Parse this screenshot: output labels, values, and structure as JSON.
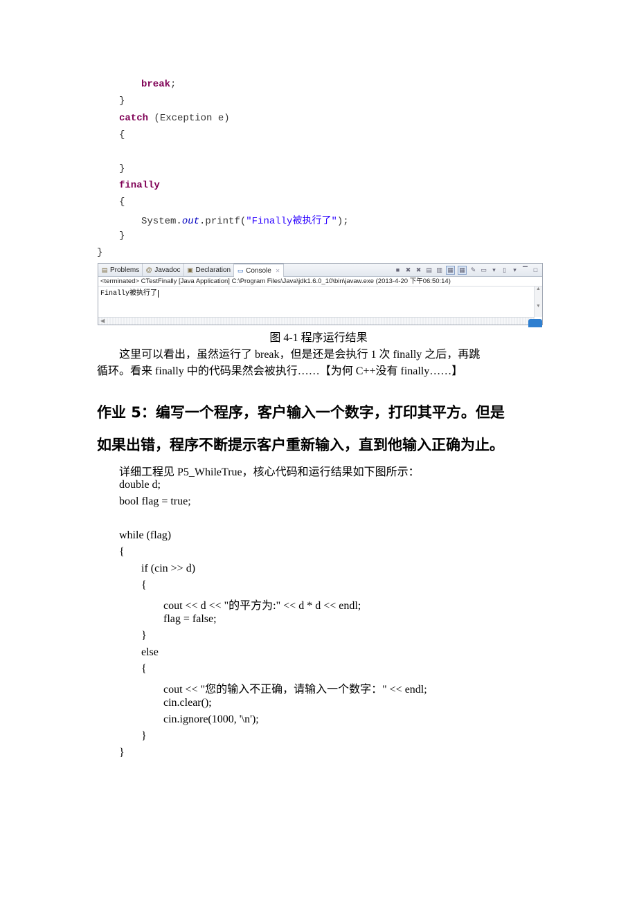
{
  "java_code": {
    "lines": [
      {
        "indent": 2,
        "parts": [
          {
            "t": "kw",
            "v": "break"
          },
          {
            "t": "plain",
            "v": ";"
          }
        ]
      },
      {
        "indent": 1,
        "parts": [
          {
            "t": "plain",
            "v": "}"
          }
        ]
      },
      {
        "indent": 1,
        "parts": [
          {
            "t": "kw",
            "v": "catch"
          },
          {
            "t": "plain",
            "v": " (Exception e)"
          }
        ]
      },
      {
        "indent": 1,
        "parts": [
          {
            "t": "plain",
            "v": "{"
          }
        ]
      },
      {
        "indent": 1,
        "parts": [
          {
            "t": "plain",
            "v": ""
          }
        ]
      },
      {
        "indent": 1,
        "parts": [
          {
            "t": "plain",
            "v": "}"
          }
        ]
      },
      {
        "indent": 1,
        "parts": [
          {
            "t": "kw",
            "v": "finally"
          }
        ]
      },
      {
        "indent": 1,
        "parts": [
          {
            "t": "plain",
            "v": "{"
          }
        ]
      },
      {
        "indent": 2,
        "parts": [
          {
            "t": "plain",
            "v": "System."
          },
          {
            "t": "ital",
            "v": "out"
          },
          {
            "t": "plain",
            "v": ".printf("
          },
          {
            "t": "str",
            "v": "\"Finally被执行了\""
          },
          {
            "t": "plain",
            "v": ");"
          }
        ]
      },
      {
        "indent": 1,
        "parts": [
          {
            "t": "plain",
            "v": "}"
          }
        ]
      },
      {
        "indent": 0,
        "parts": [
          {
            "t": "plain",
            "v": "}"
          }
        ]
      }
    ]
  },
  "console": {
    "tabs": [
      {
        "icon": "problems-icon",
        "glyph": "▤",
        "label": "Problems",
        "active": false
      },
      {
        "icon": "javadoc-icon",
        "glyph": "@",
        "label": "Javadoc",
        "active": false
      },
      {
        "icon": "declaration-icon",
        "glyph": "▣",
        "label": "Declaration",
        "active": false
      },
      {
        "icon": "console-icon",
        "glyph": "▭",
        "label": "Console",
        "active": true,
        "close": "✕"
      }
    ],
    "toolbar": [
      {
        "name": "terminate-icon",
        "glyph": "■",
        "pressed": false
      },
      {
        "name": "remove-launch-icon",
        "glyph": "✖",
        "pressed": false
      },
      {
        "name": "remove-all-terminated-icon",
        "glyph": "✖",
        "pressed": false
      },
      {
        "name": "clear-console-icon",
        "glyph": "▤",
        "pressed": false
      },
      {
        "name": "scroll-lock-icon",
        "glyph": "▥",
        "pressed": false
      },
      {
        "name": "show-on-stdout-icon",
        "glyph": "▦",
        "pressed": true
      },
      {
        "name": "show-on-stderr-icon",
        "glyph": "▦",
        "pressed": true
      },
      {
        "name": "pin-console-icon",
        "glyph": "✎",
        "pressed": false
      },
      {
        "name": "display-console-icon",
        "glyph": "▭",
        "pressed": false
      },
      {
        "name": "display-console-dropdown-icon",
        "glyph": "▾",
        "pressed": false
      },
      {
        "name": "open-console-icon",
        "glyph": "▯",
        "pressed": false
      },
      {
        "name": "open-console-dropdown-icon",
        "glyph": "▾",
        "pressed": false
      },
      {
        "name": "minimize-icon",
        "glyph": "▔",
        "pressed": false
      },
      {
        "name": "maximize-icon",
        "glyph": "□",
        "pressed": false
      }
    ],
    "status": "<terminated> CTestFinally [Java Application] C:\\Program Files\\Java\\jdk1.6.0_10\\bin\\javaw.exe (2013-4-20 下午06:50:14)",
    "output": "Finally被执行了"
  },
  "caption": "图 4-1  程序运行结果",
  "paragraph": {
    "line1": "这里可以看出，虽然运行了 break，但是还是会执行 1 次 finally 之后，再跳",
    "line2": "循环。看来 finally 中的代码果然会被执行……【为何 C++没有 finally……】"
  },
  "heading": {
    "line1": "作业 5：编写一个程序，客户输入一个数字，打印其平方。但是",
    "line2": "如果出错，程序不断提示客户重新输入，直到他输入正确为止。"
  },
  "intro": "详细工程见 P5_WhileTrue，核心代码和运行结果如下图所示：",
  "cpp_code": [
    {
      "indent": 0,
      "text": "double d;"
    },
    {
      "indent": 0,
      "text": "bool flag = true;"
    },
    {
      "indent": 0,
      "text": ""
    },
    {
      "indent": 0,
      "text": "while (flag)"
    },
    {
      "indent": 0,
      "text": "{"
    },
    {
      "indent": 1,
      "text": "if (cin >> d)"
    },
    {
      "indent": 1,
      "text": "{"
    },
    {
      "indent": 2,
      "text": "cout << d << \"的平方为:\" << d * d << endl;"
    },
    {
      "indent": 2,
      "text": "flag = false;"
    },
    {
      "indent": 1,
      "text": "}"
    },
    {
      "indent": 1,
      "text": "else"
    },
    {
      "indent": 1,
      "text": "{"
    },
    {
      "indent": 2,
      "text": "cout << \"您的输入不正确，请输入一个数字：\" << endl;"
    },
    {
      "indent": 2,
      "text": "cin.clear();"
    },
    {
      "indent": 2,
      "text": "cin.ignore(1000, '\\n');"
    },
    {
      "indent": 1,
      "text": "}"
    },
    {
      "indent": 0,
      "text": "}"
    }
  ]
}
